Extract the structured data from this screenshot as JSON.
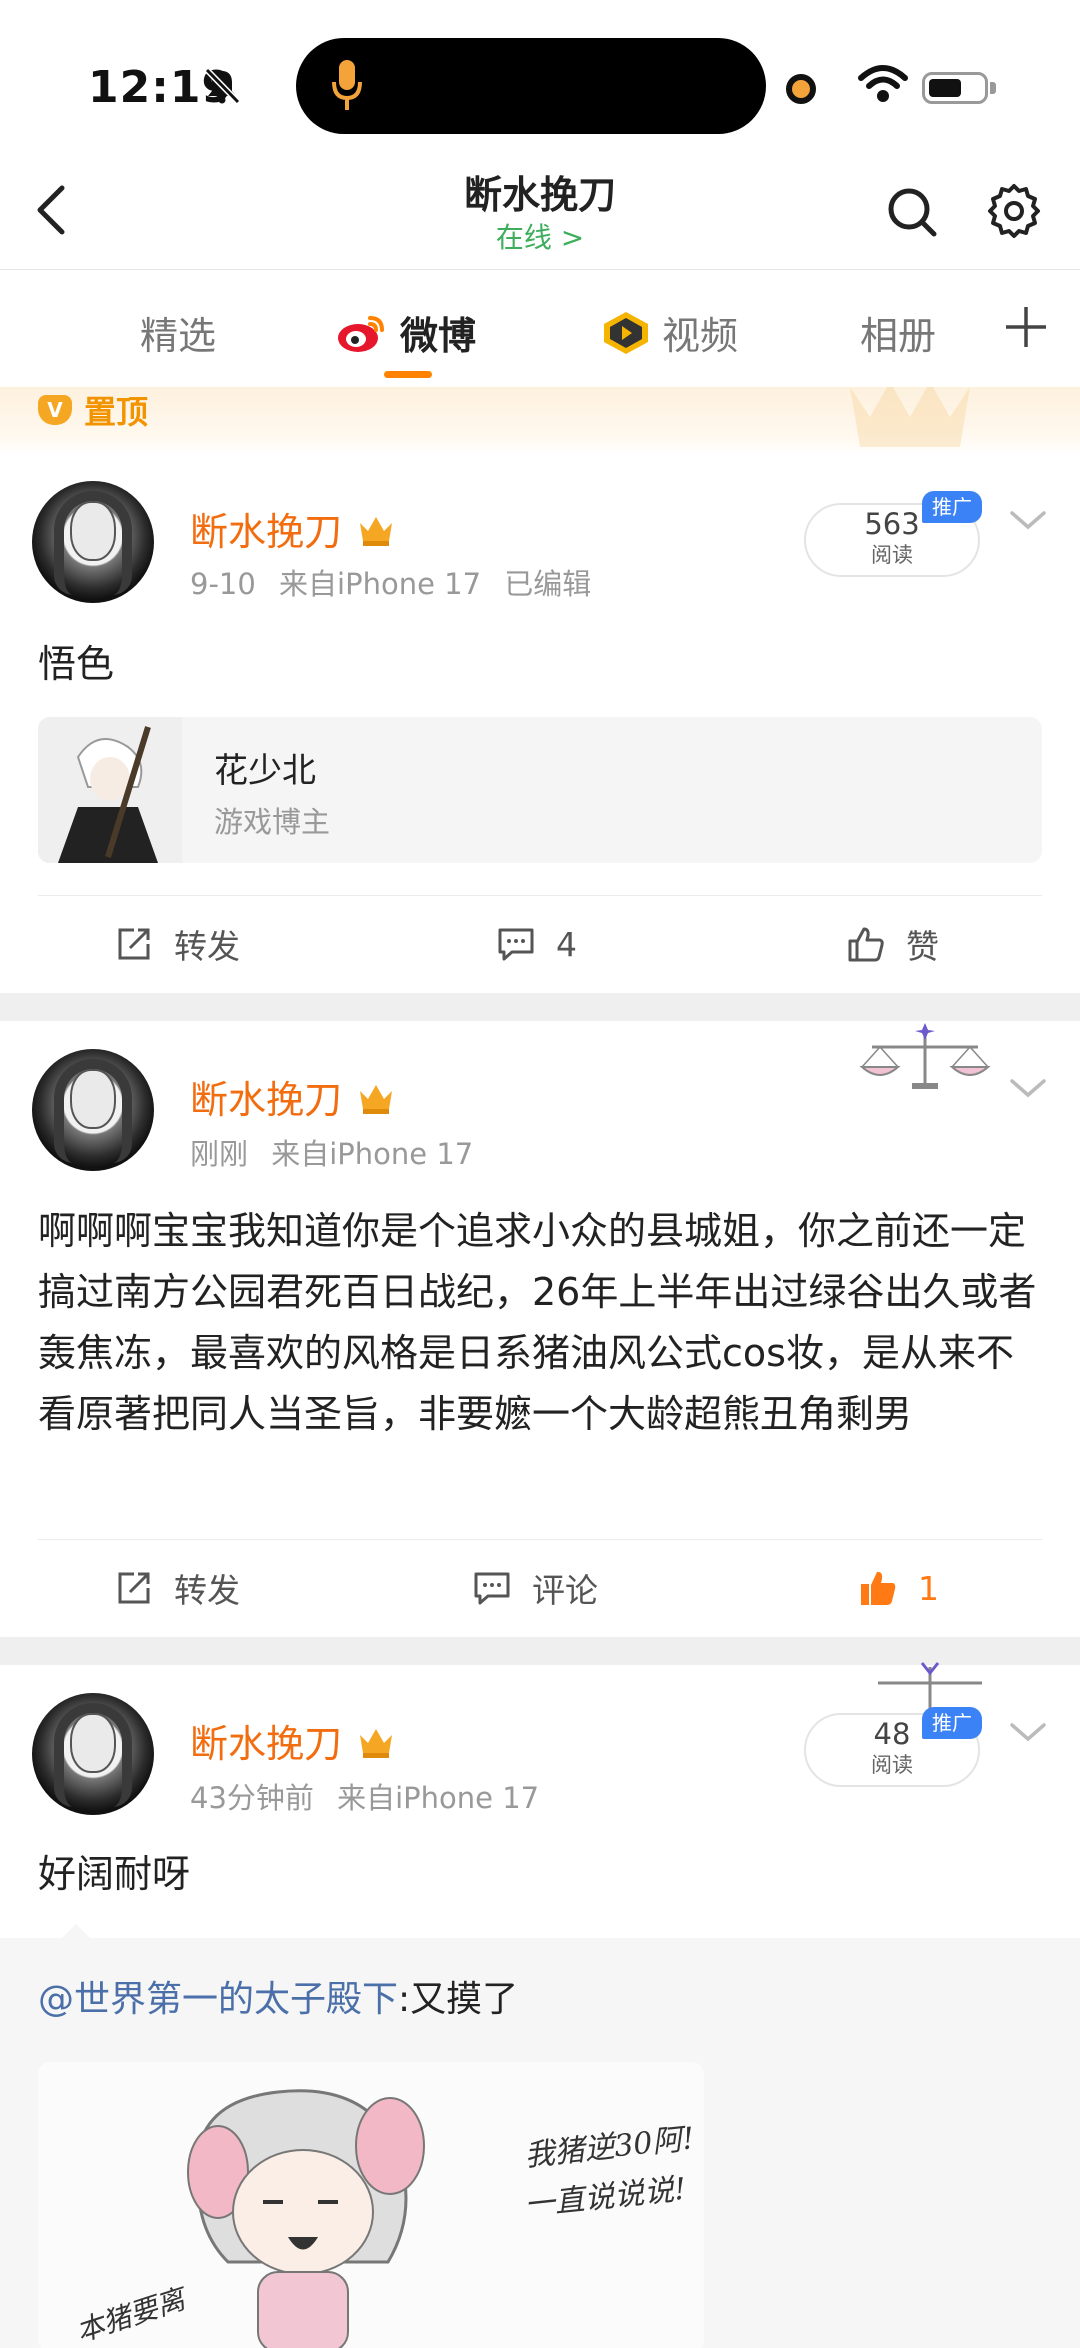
{
  "status_bar": {
    "time": "12:19"
  },
  "nav": {
    "title": "断水挽刀",
    "subtitle": "在线 >"
  },
  "tabs": [
    {
      "label": "精选"
    },
    {
      "label": "微博"
    },
    {
      "label": "视频"
    },
    {
      "label": "相册"
    }
  ],
  "pinned": {
    "label": "置顶"
  },
  "posts": [
    {
      "username": "断水挽刀",
      "date": "9-10",
      "source": "来自iPhone 17",
      "edited": "已编辑",
      "reads": "563",
      "reads_label": "阅读",
      "promo": "推广",
      "text": "悟色",
      "shared_card": {
        "name": "花少北",
        "subtitle": "游戏博主"
      },
      "actions": {
        "repost": "转发",
        "comment": "4",
        "like": "赞"
      }
    },
    {
      "username": "断水挽刀",
      "date": "刚刚",
      "source": "来自iPhone 17",
      "text": "啊啊啊宝宝我知道你是个追求小众的县城姐，你之前还一定搞过南方公园君死百日战纪，26年上半年出过绿谷出久或者轰焦冻，最喜欢的风格是日系猪油风公式cos妆，是从来不看原著把同人当圣旨，非要嬷一个大龄超熊丑角剩男",
      "actions": {
        "repost": "转发",
        "comment": "评论",
        "like": "1"
      }
    },
    {
      "username": "断水挽刀",
      "date": "43分钟前",
      "source": "来自iPhone 17",
      "reads": "48",
      "reads_label": "阅读",
      "promo": "推广",
      "text": "好阔耐呀",
      "repost": {
        "user": "@世界第一的太子殿下",
        "text": ":又摸了"
      },
      "image_text": {
        "line1": "我猪逆30阿!",
        "line2": "一直说说说!",
        "line3": "本猪要离"
      }
    }
  ],
  "colors": {
    "accent": "#ff8200",
    "username": "#f26d0f",
    "online": "#3fae5c",
    "link": "#4b6fa8",
    "promo": "#3b82f6"
  }
}
